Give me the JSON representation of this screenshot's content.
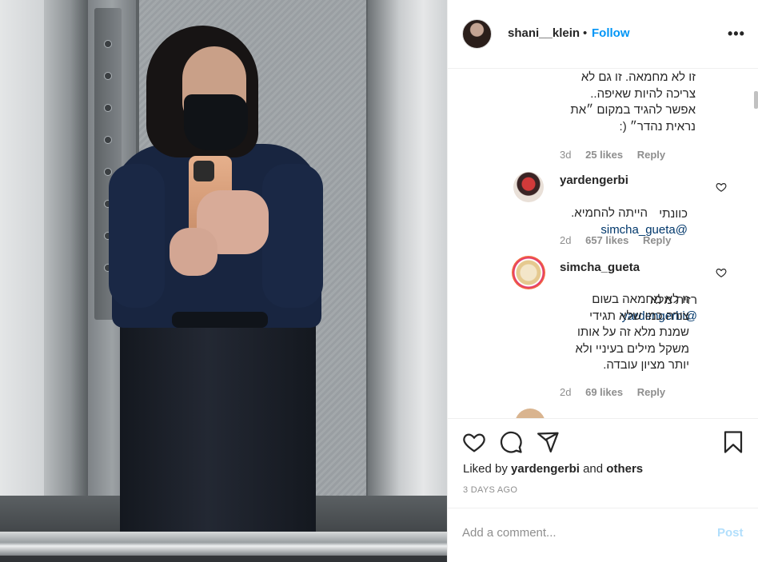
{
  "post": {
    "username": "shani__klein",
    "follow_label": "Follow",
    "dot": "•",
    "more_label": "•••"
  },
  "comments": [
    {
      "text": "זו לא מחמאה. זו גם לא\nצריכה להיות שאיפה..\nאפשר להגיד במקום ״את\nנראית נהדר״ (:",
      "time": "3d",
      "likes": "25 likes",
      "reply": "Reply"
    },
    {
      "username": "yardengerbi",
      "mention": "@simcha_gueta",
      "text_first": "כוונתי",
      "text_rest": "הייתה להחמיא.",
      "time": "2d",
      "likes": "657 likes",
      "reply": "Reply"
    },
    {
      "username": "simcha_gueta",
      "mention": "@yardengerbi",
      "text_first": "רזית מלא",
      "text_rest": "זו לא מחמאה בשום\nצורה.כמו שלא תגידי\nשמנת מלא זה על אותו\nמשקל מילים בעיניי ולא\nיותר מציון עובדה.",
      "time": "2d",
      "likes": "69 likes",
      "reply": "Reply"
    }
  ],
  "actions": {
    "liked_prefix": "Liked by ",
    "liked_user": "yardengerbi",
    "liked_mid": " and ",
    "liked_others": "others",
    "time_ago": "3 DAYS AGO",
    "icons": [
      "heart-icon",
      "comment-icon",
      "share-icon",
      "bookmark-icon"
    ]
  },
  "add_comment": {
    "placeholder": "Add a comment...",
    "post_label": "Post"
  },
  "colors": {
    "link": "#0095f6",
    "mention": "#00376b",
    "muted": "#8e8e8e",
    "post_disabled": "#b2dffc"
  }
}
